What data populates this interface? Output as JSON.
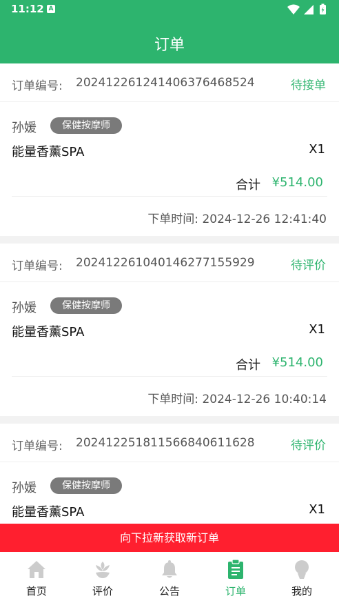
{
  "status_bar": {
    "time": "11:12",
    "notification_icon": "A"
  },
  "app_bar": {
    "title": "订单"
  },
  "orders": [
    {
      "order_no_label": "订单编号:",
      "order_no": "20241226124140637646852​4",
      "status": "待接单",
      "therapist": "孙媛",
      "badge": "保健按摩师",
      "service": "能量香薰SPA",
      "quantity": "X1",
      "total_label": "合计",
      "total": "¥514.00",
      "time": "下单时间: 2024-12-26 12:41:40"
    },
    {
      "order_no_label": "订单编号:",
      "order_no": "202412261040146277155929",
      "status": "待评价",
      "therapist": "孙媛",
      "badge": "保健按摩师",
      "service": "能量香薰SPA",
      "quantity": "X1",
      "total_label": "合计",
      "total": "¥514.00",
      "time": "下单时间: 2024-12-26 10:40:14"
    },
    {
      "order_no_label": "订单编号:",
      "order_no": "202412251811566840611628",
      "status": "待评价",
      "therapist": "孙媛",
      "badge": "保健按摩师",
      "service": "能量香薰SPA",
      "quantity": "X1",
      "total_label": "合计",
      "total": "",
      "time": ""
    }
  ],
  "refresh_banner": "向下拉新获取新订单",
  "tabs": [
    {
      "label": "首页",
      "icon": "home-icon"
    },
    {
      "label": "评价",
      "icon": "flower-icon"
    },
    {
      "label": "公告",
      "icon": "bell-icon"
    },
    {
      "label": "订单",
      "icon": "clipboard-icon",
      "active": true
    },
    {
      "label": "我的",
      "icon": "person-icon"
    }
  ],
  "colors": {
    "primary": "#2db46e",
    "banner": "#ff1f2f",
    "badge": "#7a7a7a",
    "tab_inactive": "#cccccc"
  }
}
